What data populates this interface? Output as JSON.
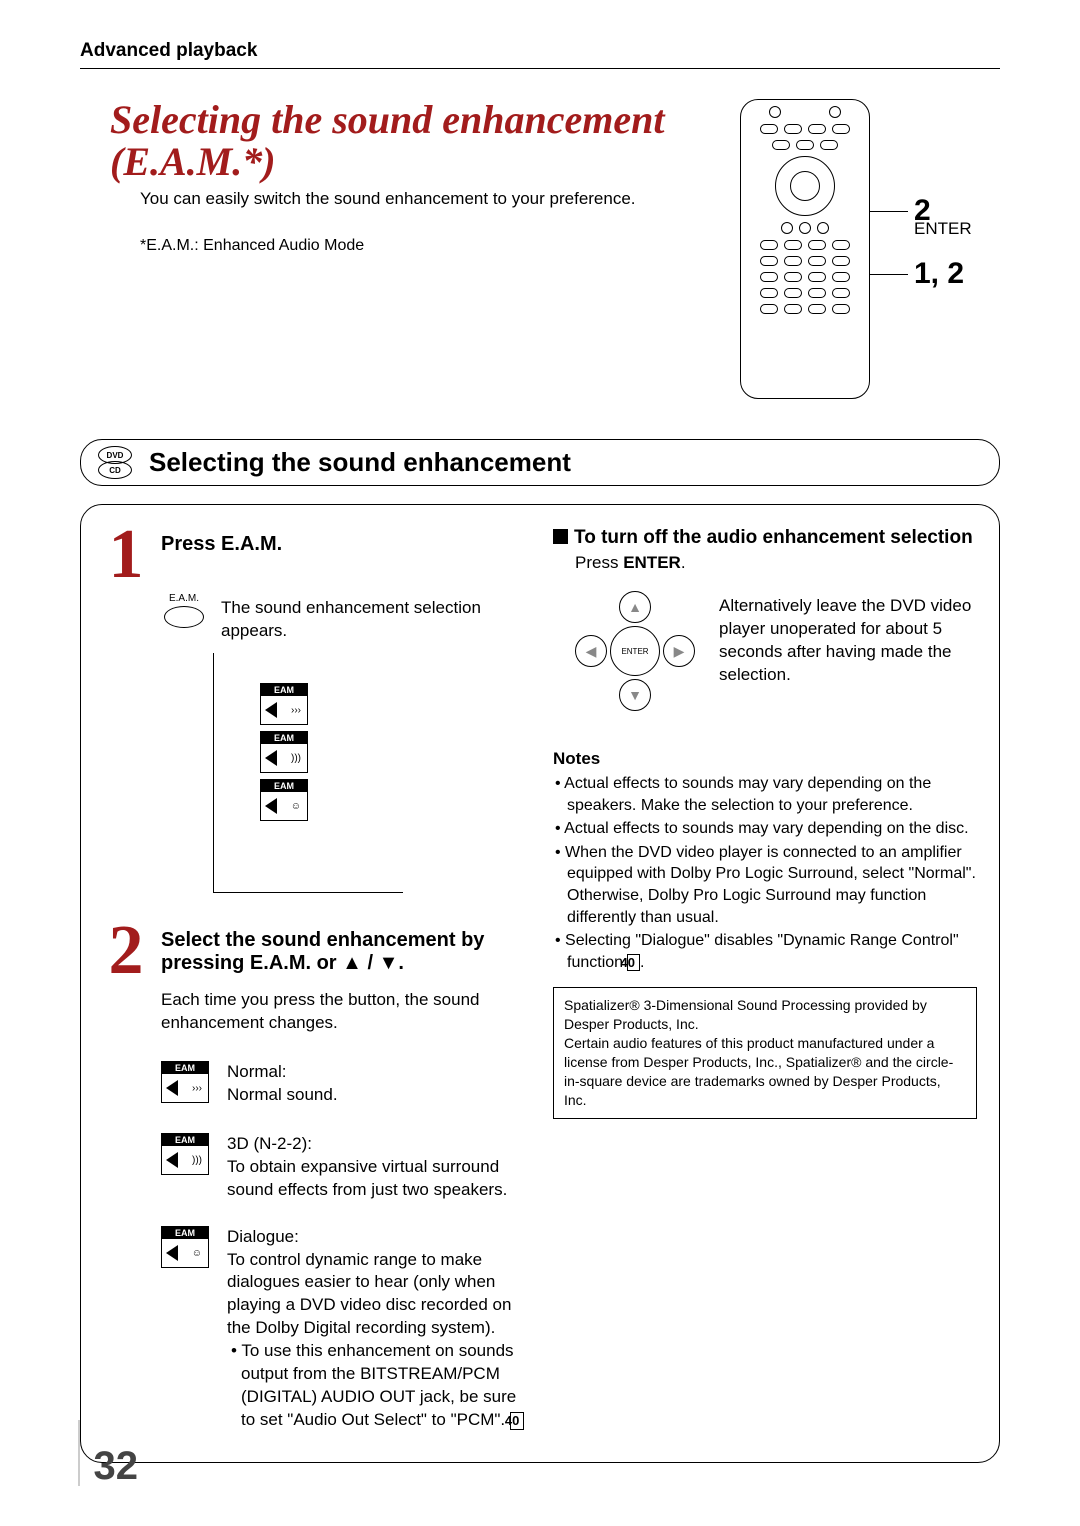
{
  "header": {
    "section": "Advanced playback"
  },
  "title": {
    "main": "Selecting the sound enhancement (E.A.M.*)",
    "sub": "You can easily switch the sound enhancement to your preference.",
    "footnote": "*E.A.M.: Enhanced Audio Mode"
  },
  "remote": {
    "callout2": "2",
    "enter_label": "ENTER",
    "callout12": "1, 2"
  },
  "bar": {
    "disc_top": "DVD",
    "disc_bottom": "CD",
    "title": "Selecting the sound enhancement"
  },
  "step1": {
    "num": "1",
    "head": "Press E.A.M.",
    "btn_label": "E.A.M.",
    "body": "The sound enhancement selection appears.",
    "icon_label": "EAM"
  },
  "step2": {
    "num": "2",
    "head": "Select the sound enhancement by pressing E.A.M. or ▲ / ▼.",
    "body": "Each time you press the button, the sound enhancement changes."
  },
  "modes": {
    "normal": {
      "title": "Normal:",
      "desc": "Normal sound."
    },
    "threeD": {
      "title": "3D (N-2-2):",
      "desc": "To obtain expansive virtual surround sound effects from just two speakers."
    },
    "dialogue": {
      "title": "Dialogue:",
      "desc": "To control dynamic range to make dialogues easier to hear (only when playing a DVD video disc recorded on the Dolby Digital recording system).",
      "bullet": "• To use this enhancement on sounds output from the BITSTREAM/PCM (DIGITAL) AUDIO OUT jack, be sure to set \"Audio Out Select\" to \"PCM\". ",
      "ref": "40"
    }
  },
  "right": {
    "turnoff_head": "To turn off the audio enhancement selection",
    "turnoff_sub_pre": "Press ",
    "turnoff_sub_bold": "ENTER",
    "turnoff_sub_post": ".",
    "enter_label": "ENTER",
    "alt_text": "Alternatively leave the DVD video player unoperated for about 5 seconds after having made the selection."
  },
  "notes": {
    "head": "Notes",
    "items": [
      "Actual effects to sounds may vary depending on the speakers.  Make the selection to your preference.",
      "Actual effects to sounds may vary depending on the disc.",
      "When the DVD video player is connected to an amplifier equipped with Dolby Pro Logic Surround, select \"Normal\". Otherwise, Dolby Pro Logic Surround may function differently than usual.",
      "Selecting \"Dialogue\" disables \"Dynamic Range Control\" function "
    ],
    "ref": "40"
  },
  "trademark": "Spatializer® 3-Dimensional Sound Processing provided by Desper Products, Inc.\nCertain audio features of this product manufactured under a license from Desper Products, Inc., Spatializer® and the circle-in-square device are trademarks owned by Desper Products, Inc.",
  "page_number": "32"
}
